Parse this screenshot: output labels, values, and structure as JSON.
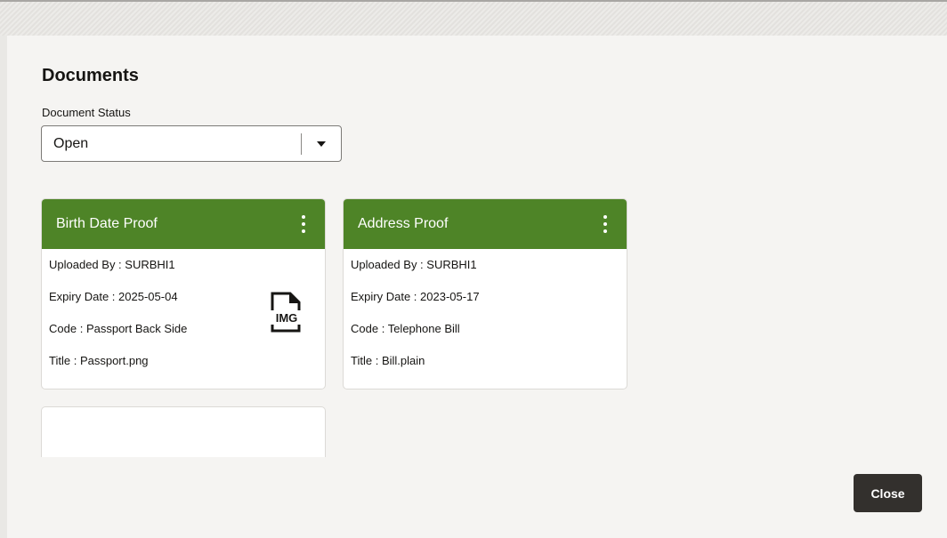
{
  "section": {
    "title": "Documents",
    "status_label": "Document Status",
    "status_value": "Open"
  },
  "cards": [
    {
      "title": "Birth Date Proof",
      "uploaded_by_label": "Uploaded By :",
      "uploaded_by": "SURBHI1",
      "expiry_label": "Expiry Date :",
      "expiry": "2025-05-04",
      "code_label": "Code :",
      "code": "Passport Back Side",
      "title_label": "Title :",
      "file_title": "Passport.png",
      "file_type_icon": "img-file-icon",
      "file_type_text": "IMG"
    },
    {
      "title": "Address Proof",
      "uploaded_by_label": "Uploaded By :",
      "uploaded_by": "SURBHI1",
      "expiry_label": "Expiry Date :",
      "expiry": "2023-05-17",
      "code_label": "Code :",
      "code": "Telephone Bill",
      "title_label": "Title :",
      "file_title": "Bill.plain"
    }
  ],
  "footer": {
    "close_label": "Close"
  },
  "colors": {
    "card_header": "#4e8427",
    "close_button": "#33302d",
    "background": "#f5f4f2"
  }
}
